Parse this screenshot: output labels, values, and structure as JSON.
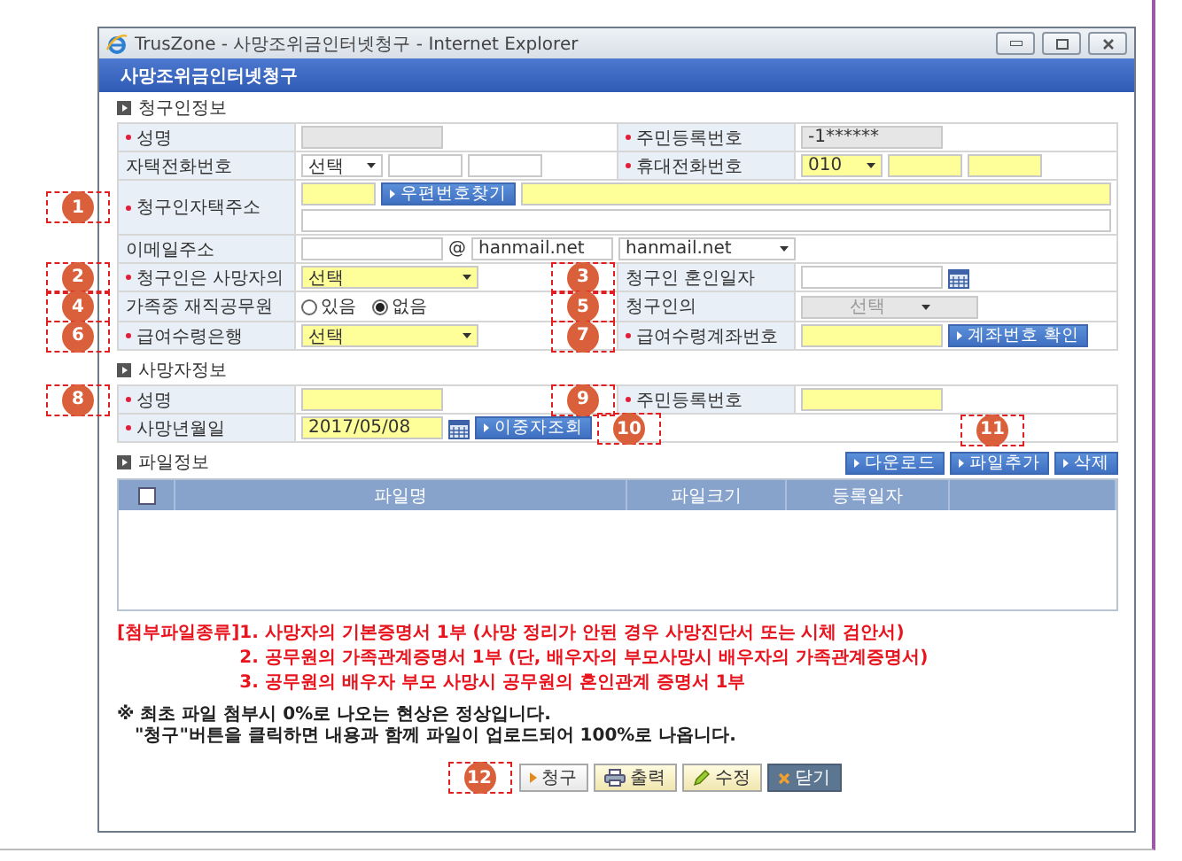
{
  "window": {
    "title": "TrusZone - 사망조위금인터넷청구 - Internet Explorer"
  },
  "page_header": "사망조위금인터넷청구",
  "claimant": {
    "title": "청구인정보",
    "rows": [
      {
        "cells": [
          {
            "kind": "label",
            "text": "성명",
            "required": true
          },
          {
            "kind": "value",
            "controls": [
              {
                "kind": "input",
                "readonly": true
              }
            ]
          },
          {
            "kind": "label",
            "text": "주민등록번호",
            "required": true
          },
          {
            "kind": "value",
            "controls": [
              {
                "kind": "input",
                "readonly": true,
                "value": "-1******"
              }
            ]
          }
        ]
      },
      {
        "cells": [
          {
            "kind": "label",
            "text": "자택전화번호",
            "required": false
          },
          {
            "kind": "value",
            "controls": [
              {
                "kind": "select",
                "value": "선택",
                "highlighted": false,
                "disabled": false
              },
              {
                "kind": "input",
                "readonly": false,
                "highlighted": false
              },
              {
                "kind": "input",
                "readonly": false,
                "highlighted": false
              }
            ]
          },
          {
            "kind": "label",
            "text": "휴대전화번호",
            "required": true
          },
          {
            "kind": "value",
            "controls": [
              {
                "kind": "select",
                "value": "010",
                "highlighted": true,
                "disabled": false
              },
              {
                "kind": "input",
                "readonly": false,
                "highlighted": true
              },
              {
                "kind": "input",
                "readonly": false,
                "highlighted": true
              }
            ]
          }
        ]
      },
      {
        "cells": [
          {
            "kind": "label",
            "text": "청구인자택주소",
            "required": true,
            "callout": "1"
          },
          {
            "kind": "value",
            "colspan": 3,
            "controls": [
              {
                "kind": "input",
                "readonly": false,
                "highlighted": true
              },
              {
                "kind": "button",
                "label": "우편번호찾기"
              },
              {
                "kind": "input",
                "readonly": false,
                "highlighted": true
              },
              {
                "kind": "input",
                "readonly": false,
                "highlighted": false
              }
            ]
          }
        ]
      },
      {
        "cells": [
          {
            "kind": "label",
            "text": "이메일주소",
            "required": false
          },
          {
            "kind": "value",
            "colspan": 3,
            "controls": [
              {
                "kind": "input",
                "readonly": false,
                "highlighted": false
              },
              {
                "kind": "at",
                "text": "@"
              },
              {
                "kind": "input",
                "readonly": false,
                "highlighted": false,
                "value": "hanmail.net"
              },
              {
                "kind": "select",
                "value": "hanmail.net",
                "highlighted": false,
                "disabled": false
              }
            ]
          }
        ]
      },
      {
        "cells": [
          {
            "kind": "label",
            "text": "청구인은 사망자의",
            "required": true,
            "callout": "2"
          },
          {
            "kind": "value",
            "controls": [
              {
                "kind": "select",
                "value": "선택",
                "highlighted": true,
                "disabled": false
              }
            ]
          },
          {
            "kind": "label",
            "text": "청구인 혼인일자",
            "required": false,
            "callout": "3"
          },
          {
            "kind": "value",
            "controls": [
              {
                "kind": "input",
                "readonly": false,
                "highlighted": false
              },
              {
                "kind": "calendar"
              }
            ]
          }
        ]
      },
      {
        "cells": [
          {
            "kind": "label",
            "text": "가족중 재직공무원",
            "required": false,
            "callout": "4"
          },
          {
            "kind": "value",
            "controls": [
              {
                "kind": "radio",
                "label": "있음",
                "selected": false
              },
              {
                "kind": "radio",
                "label": "없음",
                "selected": true
              }
            ]
          },
          {
            "kind": "label",
            "text": "청구인의",
            "required": false,
            "callout": "5"
          },
          {
            "kind": "value",
            "controls": [
              {
                "kind": "select",
                "value": "선택",
                "disabled": true
              }
            ]
          }
        ]
      },
      {
        "cells": [
          {
            "kind": "label",
            "text": "급여수령은행",
            "required": true,
            "callout": "6"
          },
          {
            "kind": "value",
            "controls": [
              {
                "kind": "select",
                "value": "선택",
                "highlighted": true,
                "disabled": false
              }
            ]
          },
          {
            "kind": "label",
            "text": "급여수령계좌번호",
            "required": true,
            "callout": "7"
          },
          {
            "kind": "value",
            "controls": [
              {
                "kind": "input",
                "readonly": false,
                "highlighted": true
              },
              {
                "kind": "button",
                "label": "계좌번호 확인"
              }
            ]
          }
        ]
      }
    ]
  },
  "deceased": {
    "title": "사망자정보",
    "rows": [
      {
        "cells": [
          {
            "kind": "label",
            "text": "성명",
            "required": true,
            "callout": "8"
          },
          {
            "kind": "value",
            "controls": [
              {
                "kind": "input",
                "readonly": false,
                "highlighted": true
              }
            ]
          },
          {
            "kind": "label",
            "text": "주민등록번호",
            "required": true,
            "callout": "9"
          },
          {
            "kind": "value",
            "controls": [
              {
                "kind": "input",
                "readonly": false,
                "highlighted": true
              }
            ]
          }
        ]
      },
      {
        "cells": [
          {
            "kind": "label",
            "text": "사망년월일",
            "required": true
          },
          {
            "kind": "value",
            "colspan": 3,
            "controls": [
              {
                "kind": "input",
                "readonly": false,
                "highlighted": true,
                "value": "2017/05/08"
              },
              {
                "kind": "calendar"
              },
              {
                "kind": "button",
                "label": "이중자조회",
                "callout": "10"
              }
            ]
          }
        ]
      }
    ]
  },
  "files": {
    "title": "파일정보",
    "buttons": [
      {
        "label": "다운로드"
      },
      {
        "label": "파일추가",
        "callout": "11"
      },
      {
        "label": "삭제"
      }
    ],
    "columns": [
      {
        "kind": "checkbox",
        "checked": false
      },
      {
        "kind": "text",
        "label": "파일명"
      },
      {
        "kind": "text",
        "label": "파일크기"
      },
      {
        "kind": "text",
        "label": "등록일자"
      }
    ]
  },
  "attachment_notes": {
    "heading": "[첨부파일종류]",
    "items": [
      "1. 사망자의 기본증명서 1부 (사망 정리가 안된 경우 사망진단서 또는 시체 검안서)",
      "2. 공무원의 가족관계증명서 1부 (단, 배우자의 부모사망시 배우자의 가족관계증명서)",
      "3. 공무원의 배우자 부모 사망시 공무원의 혼인관계 증명서 1부"
    ]
  },
  "notices": [
    "※ 최초 파일 첨부시 0%로 나오는 현상은 정상입니다.",
    "\"청구\"버튼을 클릭하면 내용과 함께 파일이 업로드되어 100%로 나옵니다."
  ],
  "actions": [
    {
      "kind": "submit",
      "label": "청구",
      "callout": "12"
    },
    {
      "kind": "print",
      "label": "출력"
    },
    {
      "kind": "edit",
      "label": "수정"
    },
    {
      "kind": "close",
      "label": "닫기"
    }
  ]
}
